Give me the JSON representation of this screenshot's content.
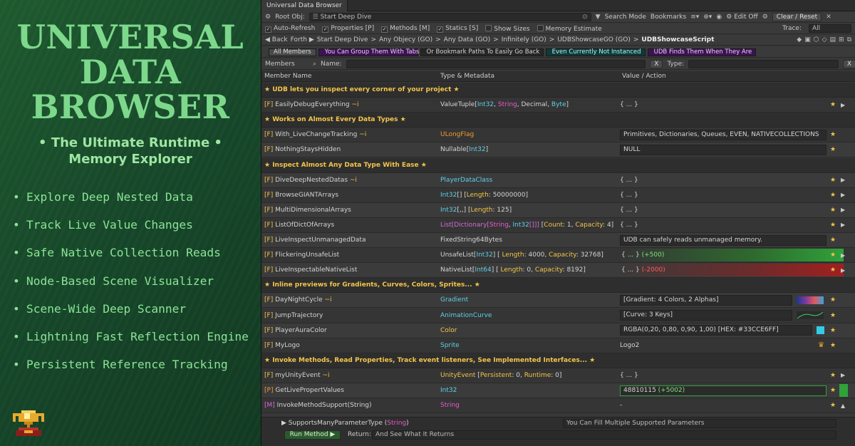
{
  "promo": {
    "title_lines": [
      "UNIVERSAL",
      "DATA",
      "BROWSER"
    ],
    "subtitle_lines": [
      "• The Ultimate Runtime •",
      "Memory Explorer"
    ],
    "features": [
      "Explore Deep Nested Data",
      "Track Live Value Changes",
      "Safe Native Collection Reads",
      "Node-Based Scene Visualizer",
      "Scene-Wide Deep Scanner",
      "Lightning Fast Reflection Engine",
      "Persistent Reference Tracking"
    ],
    "logo_icon": "trophy-icon"
  },
  "window": {
    "title": "Universal Data Browser"
  },
  "toolbar": {
    "root_label": "Root Obj:",
    "root_value": "Start Deep Dive",
    "search_mode": "Search Mode",
    "bookmarks": "Bookmarks",
    "edit_off": "Edit Off",
    "clear_reset": "Clear / Reset",
    "options": [
      {
        "label": "Auto-Refresh",
        "checked": true
      },
      {
        "label": "Properties [P]",
        "checked": true
      },
      {
        "label": "Methods [M]",
        "checked": true
      },
      {
        "label": "Statics [S]",
        "checked": true
      },
      {
        "label": "Show Sizes",
        "checked": false
      },
      {
        "label": "Memory Estimate",
        "checked": false
      }
    ],
    "trace_label": "Trace:",
    "trace_value": "All"
  },
  "nav": {
    "back": "Back",
    "forth": "Forth",
    "path": [
      "Start Deep Dive",
      "Any Objecy (GO)",
      "Any Data (GO)",
      "Infinitely (GO)",
      "UDBShowcaseGO (GO)",
      "UDBShowcaseScript"
    ]
  },
  "group_tabs": [
    {
      "label": "All Members",
      "bg": "#4a4a4a",
      "fg": "#dddddd"
    },
    {
      "label": "You Can Group Them With Tabs",
      "bg": "#3a1450",
      "fg": "#f0c8ff"
    },
    {
      "label": "Or Bookmark Paths To Easily Go Back",
      "bg": "#262626",
      "fg": "#d4d4d4"
    },
    {
      "label": "Even Currently Not Instanced",
      "bg": "#0d3a3a",
      "fg": "#bff0f0"
    },
    {
      "label": "UDB Finds Them When They Are",
      "bg": "#3a1450",
      "fg": "#f0c8ff"
    }
  ],
  "filter": {
    "members_label": "Members",
    "name_label": "Name:",
    "x": "X",
    "type_label": "Type:"
  },
  "columns": {
    "name": "Member Name",
    "type": "Type & Metadata",
    "value": "Value / Action"
  },
  "rows": [
    {
      "kind": "section",
      "text": "★ UDB lets you inspect every corner of your project ★"
    },
    {
      "kind": "member",
      "prefix": "[F]",
      "name": "EasilyDebugEverything",
      "mod": " ~i",
      "type": [
        [
          "ValueTuple[",
          "w"
        ],
        [
          "Int32",
          "c"
        ],
        [
          ", ",
          "w"
        ],
        [
          "String",
          "s"
        ],
        [
          ", ",
          "w"
        ],
        [
          "Decimal",
          "w"
        ],
        [
          ", ",
          "w"
        ],
        [
          "Byte",
          "c"
        ],
        [
          "]",
          "w"
        ]
      ],
      "value": [
        [
          "{ ... }",
          "w"
        ]
      ],
      "vstyle": "plain",
      "arrow": true
    },
    {
      "kind": "section",
      "text": "★ Works on Almost Every Data Types ★"
    },
    {
      "kind": "member",
      "prefix": "[F]",
      "name": "With_LiveChangeTracking",
      "mod": " ~i",
      "type": [
        [
          "ULongFlag",
          "o"
        ]
      ],
      "value": [
        [
          "Primitives, Dictionaries, Queues, EVEN, NATIVECOLLECTIONS",
          "w"
        ]
      ],
      "vstyle": "box"
    },
    {
      "kind": "member",
      "prefix": "[F]",
      "name": "NothingStaysHidden",
      "mod": "",
      "type": [
        [
          "Nullable[",
          "w"
        ],
        [
          "Int32",
          "c"
        ],
        [
          "]",
          "w"
        ]
      ],
      "value": [
        [
          "NULL",
          "w"
        ]
      ],
      "vstyle": "box"
    },
    {
      "kind": "section",
      "text": "★ Inspect Almost Any Data Type With Ease ★"
    },
    {
      "kind": "member",
      "prefix": "[F]",
      "name": "DiveDeepNestedDatas",
      "mod": " ~i",
      "type": [
        [
          "PlayerDataClass",
          "c"
        ]
      ],
      "value": [
        [
          "{ ... }",
          "w"
        ]
      ],
      "vstyle": "plain",
      "arrow": true
    },
    {
      "kind": "member",
      "prefix": "[F]",
      "name": "BrowseGIANTArrays",
      "mod": "",
      "type": [
        [
          "Int32",
          "c"
        ],
        [
          "[] [",
          "w"
        ],
        [
          "Length",
          "y"
        ],
        [
          ": 50000000]",
          "w"
        ]
      ],
      "value": [
        [
          "{ ... }",
          "w"
        ]
      ],
      "vstyle": "plain",
      "arrow": true
    },
    {
      "kind": "member",
      "prefix": "[F]",
      "name": "MultiDimensionalArrays",
      "mod": "",
      "type": [
        [
          "Int32",
          "c"
        ],
        [
          "[,,] [",
          "w"
        ],
        [
          "Length",
          "y"
        ],
        [
          ": 125]",
          "w"
        ]
      ],
      "value": [
        [
          "{ ... }",
          "w"
        ]
      ],
      "vstyle": "plain",
      "arrow": true
    },
    {
      "kind": "member",
      "prefix": "[F]",
      "name": "ListOfDictOfArrays",
      "mod": "",
      "type": [
        [
          "List[",
          "m"
        ],
        [
          "Dictionary[",
          "m"
        ],
        [
          "String",
          "s"
        ],
        [
          ", ",
          "w"
        ],
        [
          "Int32",
          "c"
        ],
        [
          "[]]]",
          "m"
        ],
        [
          " [",
          "w"
        ],
        [
          "Count",
          "y"
        ],
        [
          ": 1, ",
          "w"
        ],
        [
          "Capacity",
          "y"
        ],
        [
          ": 4]",
          "w"
        ]
      ],
      "value": [
        [
          "{ ... }",
          "w"
        ]
      ],
      "vstyle": "plain",
      "arrow": true
    },
    {
      "kind": "member",
      "prefix": "[F]",
      "name": "LiveInspectUnmanagedData",
      "mod": "",
      "type": [
        [
          "FixedString64Bytes",
          "w"
        ]
      ],
      "value": [
        [
          "UDB can safely reads unmanaged memory.",
          "w"
        ]
      ],
      "vstyle": "box"
    },
    {
      "kind": "member",
      "prefix": "[F]",
      "name": "FlickeringUnsafeList",
      "mod": "",
      "type": [
        [
          "UnsafeList[",
          "w"
        ],
        [
          "Int32",
          "c"
        ],
        [
          "] [ ",
          "w"
        ],
        [
          "Length",
          "y"
        ],
        [
          ": 4000, ",
          "w"
        ],
        [
          "Capacity",
          "y"
        ],
        [
          ": 32768]",
          "w"
        ]
      ],
      "value": [
        [
          "{ ... } ",
          "w"
        ],
        [
          "(+500)",
          "g"
        ]
      ],
      "vstyle": "green",
      "arrow": true
    },
    {
      "kind": "member",
      "prefix": "[F]",
      "name": "LiveInspectableNativeList",
      "mod": "",
      "type": [
        [
          "NativeList[",
          "w"
        ],
        [
          "Int64",
          "c"
        ],
        [
          "] [ ",
          "w"
        ],
        [
          "Length",
          "y"
        ],
        [
          ": 0, ",
          "w"
        ],
        [
          "Capacity",
          "y"
        ],
        [
          ": 8192]",
          "w"
        ]
      ],
      "value": [
        [
          "{ ... } ",
          "w"
        ],
        [
          "(-2000)",
          "r"
        ]
      ],
      "vstyle": "red",
      "arrow": true
    },
    {
      "kind": "section",
      "text": "★ Inline previews for Gradients, Curves, Colors, Sprites... ★"
    },
    {
      "kind": "member",
      "prefix": "[F]",
      "name": "DayNightCycle",
      "mod": " ~i",
      "type": [
        [
          "Gradient",
          "c"
        ]
      ],
      "value": [
        [
          "[Gradient: 4 Colors, 2 Alphas]",
          "w"
        ]
      ],
      "vstyle": "box",
      "extra": "gradient"
    },
    {
      "kind": "member",
      "prefix": "[F]",
      "name": "JumpTrajectory",
      "mod": "",
      "type": [
        [
          "AnimationCurve",
          "c"
        ]
      ],
      "value": [
        [
          "[Curve: 3 Keys]",
          "w"
        ]
      ],
      "vstyle": "box",
      "extra": "curve"
    },
    {
      "kind": "member",
      "prefix": "[F]",
      "name": "PlayerAuraColor",
      "mod": "",
      "type": [
        [
          "Color",
          "y"
        ]
      ],
      "value": [
        [
          "RGBA(0,20, 0,80, 0,90, 1,00)  [HEX: #33CCE6FF]",
          "w"
        ]
      ],
      "vstyle": "box",
      "extra": "swatch",
      "swatch": "#33CCE6"
    },
    {
      "kind": "member",
      "prefix": "[F]",
      "name": "MyLogo",
      "mod": "",
      "type": [
        [
          "Sprite",
          "c"
        ]
      ],
      "value": [
        [
          "Logo2",
          "w"
        ]
      ],
      "vstyle": "plain",
      "extra": "sprite"
    },
    {
      "kind": "section",
      "text": "★ Invoke Methods, Read Properties, Track event listeners, See Implemented Interfaces... ★"
    },
    {
      "kind": "member",
      "prefix": "[F]",
      "name": "myUnityEvent",
      "mod": " ~i",
      "type": [
        [
          "UnityEvent",
          "y"
        ],
        [
          " [",
          "w"
        ],
        [
          "Persistent",
          "y"
        ],
        [
          ": 0, ",
          "w"
        ],
        [
          "Runtime",
          "y"
        ],
        [
          ": 0]",
          "w"
        ]
      ],
      "value": [
        [
          "{ ... }",
          "w"
        ]
      ],
      "vstyle": "plain",
      "arrow": true
    },
    {
      "kind": "member",
      "prefix": "[P]",
      "name": "GetLivePropertValues",
      "mod": "",
      "type": [
        [
          "Int32",
          "c"
        ]
      ],
      "value": [
        [
          "48810115 ",
          "w"
        ],
        [
          "(+5002)",
          "g"
        ]
      ],
      "vstyle": "box-green"
    },
    {
      "kind": "member",
      "prefix": "[M]",
      "name": "InvokeMethodSupport(String)",
      "mod": "",
      "type": [
        [
          "String",
          "s"
        ]
      ],
      "value": [
        [
          "-",
          "w"
        ]
      ],
      "vstyle": "plain",
      "arrow_up": true
    }
  ],
  "method_panel": {
    "param_name": "SupportsManyParameterType",
    "param_type_open": " (",
    "param_type": "String",
    "param_type_close": ")",
    "param_value": "You Can Fill Multiple Supported Parameters",
    "run_label": "Run Method ▶",
    "return_label": "Return:",
    "return_value": "And See What It Returns"
  },
  "colors": {
    "accent_gold": "#F3C54A",
    "cyan": "#5FD0E8",
    "pink": "#E85AD0",
    "orange": "#F29A2E",
    "green": "#7FE07F",
    "red": "#FF5A5A",
    "promo_green": "#7DD88C"
  }
}
